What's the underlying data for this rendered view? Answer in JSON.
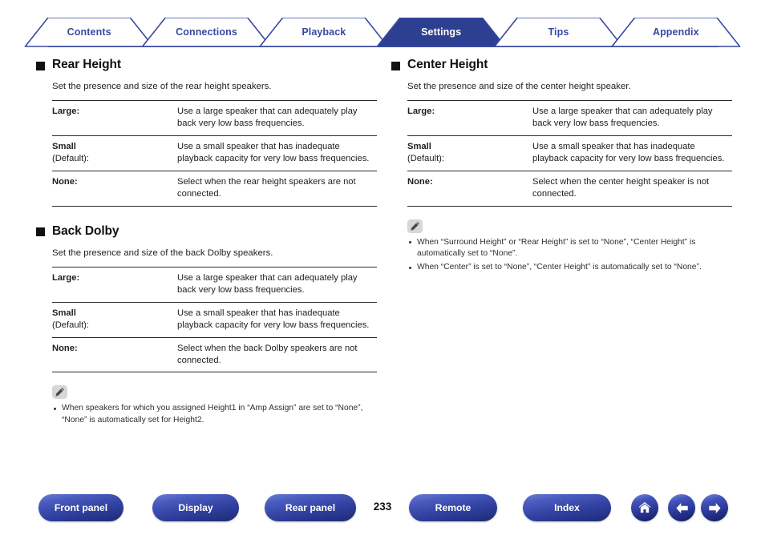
{
  "tabs": [
    {
      "label": "Contents",
      "active": false
    },
    {
      "label": "Connections",
      "active": false
    },
    {
      "label": "Playback",
      "active": false
    },
    {
      "label": "Settings",
      "active": true
    },
    {
      "label": "Tips",
      "active": false
    },
    {
      "label": "Appendix",
      "active": false
    }
  ],
  "colors": {
    "tab_outline": "#3a4a9f",
    "tab_text": "#3a4a9f",
    "tab_active_bg": "#2d3f91",
    "tab_active_text": "#ffffff",
    "button_blue": "#2f3f9e",
    "rule": "#2b2b2b"
  },
  "left_column": {
    "sections": [
      {
        "heading": "Rear Height",
        "intro": "Set the presence and size of the rear height speakers.",
        "rows": [
          {
            "key": "Large:",
            "key_sub": "",
            "value": "Use a large speaker that can adequately play back very low bass frequencies."
          },
          {
            "key": "Small",
            "key_sub": "(Default):",
            "value": "Use a small speaker that has inadequate playback capacity for very low bass frequencies."
          },
          {
            "key": "None:",
            "key_sub": "",
            "value": "Select when the rear height speakers are not connected."
          }
        ]
      },
      {
        "heading": "Back Dolby",
        "intro": "Set the presence and size of the back Dolby speakers.",
        "rows": [
          {
            "key": "Large:",
            "key_sub": "",
            "value": "Use a large speaker that can adequately play back very low bass frequencies."
          },
          {
            "key": "Small",
            "key_sub": "(Default):",
            "value": "Use a small speaker that has inadequate playback capacity for very low bass frequencies."
          },
          {
            "key": "None:",
            "key_sub": "",
            "value": "Select when the back Dolby speakers are not connected."
          }
        ]
      }
    ],
    "note": {
      "icon": "pencil-icon",
      "bullets": [
        "When speakers for which you assigned Height1 in “Amp Assign” are set to “None”, “None” is automatically set for Height2."
      ]
    }
  },
  "right_column": {
    "sections": [
      {
        "heading": "Center Height",
        "intro": "Set the presence and size of the center height speaker.",
        "rows": [
          {
            "key": "Large:",
            "key_sub": "",
            "value": "Use a large speaker that can adequately play back very low bass frequencies."
          },
          {
            "key": "Small",
            "key_sub": "(Default):",
            "value": "Use a small speaker that has inadequate playback capacity for very low bass frequencies."
          },
          {
            "key": "None:",
            "key_sub": "",
            "value": "Select when the center height speaker is not connected."
          }
        ]
      }
    ],
    "note": {
      "icon": "pencil-icon",
      "bullets": [
        "When “Surround Height” or “Rear Height” is set to “None”, “Center Height” is automatically set to “None”.",
        "When “Center” is set to “None”, “Center Height” is automatically set to “None”."
      ]
    }
  },
  "footer": {
    "buttons": [
      {
        "label": "Front panel"
      },
      {
        "label": "Display"
      },
      {
        "label": "Rear panel"
      },
      {
        "label": "Remote"
      },
      {
        "label": "Index"
      }
    ],
    "page_number": "233",
    "icon_buttons": [
      {
        "name": "home-icon"
      },
      {
        "name": "arrow-left-icon"
      },
      {
        "name": "arrow-right-icon"
      }
    ]
  }
}
